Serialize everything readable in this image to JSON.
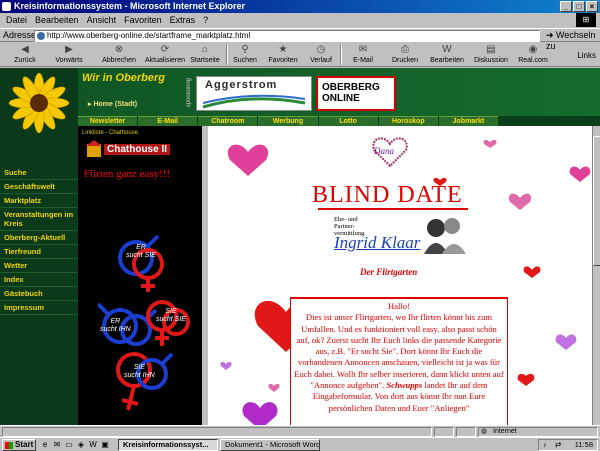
{
  "window": {
    "title": "Kreisinformationssystem - Microsoft Internet Explorer"
  },
  "menu": [
    "Datei",
    "Bearbeiten",
    "Ansicht",
    "Favoriten",
    "Extras",
    "?"
  ],
  "address": {
    "label": "Adresse",
    "url": "http://www.oberberg-online.de/startframe_marktplatz.html",
    "go_label": "Wechseln zu"
  },
  "toolbar": [
    {
      "label": "Zurück",
      "icon": "back-icon"
    },
    {
      "label": "Vorwärts",
      "icon": "forward-icon"
    },
    {
      "label": "Abbrechen",
      "icon": "stop-icon"
    },
    {
      "label": "Aktualisieren",
      "icon": "refresh-icon"
    },
    {
      "label": "Startseite",
      "icon": "home-icon"
    },
    {
      "label": "Suchen",
      "icon": "search-icon"
    },
    {
      "label": "Favoriten",
      "icon": "favorites-icon"
    },
    {
      "label": "Verlauf",
      "icon": "history-icon"
    },
    {
      "label": "E-Mail",
      "icon": "mail-icon"
    },
    {
      "label": "Drucken",
      "icon": "print-icon"
    },
    {
      "label": "Bearbeiten",
      "icon": "edit-icon"
    },
    {
      "label": "Diskussion",
      "icon": "discuss-icon"
    },
    {
      "label": "Real.com",
      "icon": "realcom-icon"
    }
  ],
  "toolbar_links": "Links",
  "site": {
    "logo": "Wir in Oberberg",
    "home_link": "Home (Stadt)",
    "sponsor_label": "sponsoring",
    "banner1": "Aggerstrom",
    "banner2_line1": "OBERBERG",
    "banner2_line2": "ONLINE",
    "tabs": [
      "Newsletter",
      "E-Mail",
      "Chatroom",
      "Werbung",
      "Lotto",
      "Horoskop",
      "Jobmarkt"
    ],
    "left_nav": [
      "Suche",
      "Geschäftswelt",
      "Marktplatz",
      "Veranstaltungen im Kreis",
      "Oberberg-Aktuell",
      "Tierfreund",
      "Wetter",
      "Index",
      "Gästebuch",
      "Impressum"
    ]
  },
  "chat": {
    "header": "Linkliste - Chathouse",
    "logo": "Chathouse II",
    "tagline": "Flirten ganz easy!!!",
    "symbols": [
      {
        "line1": "ER",
        "line2": "sucht SIE"
      },
      {
        "line1": "ER",
        "line2": "sucht IHN"
      },
      {
        "line1": "SIE",
        "line2": "sucht SIE"
      },
      {
        "line1": "SIE",
        "line2": "sucht IHN"
      }
    ]
  },
  "main": {
    "dana": "Dana",
    "title": "BLIND DATE",
    "ehe": "Ehe- und Partner- vermittlung",
    "ingrid": "Ingrid Klaar",
    "garten": "Der Flirtgarten",
    "greeting": "Hallo!",
    "body": "Dies ist unser Flirtgarten, wo Ihr flirten könnt bis zum Umfallen. Und es funktioniert voll easy, also passt schön auf, ok? Zuerst sucht Ihr Euch links die passende Kategorie aus, z.B. \"Er sucht Sie\". Dort könnt Ihr Euch die vorhandenen Annoncen anschauen, vielleicht ist ja was für Euch dabei. Wollt Ihr selber inserieren, dann klickt unten auf \"Annonce aufgeben\".",
    "schwupps": "Schwupps",
    "body2": "landet Ihr auf dem Eingabeformular. Von dort aus könnt Ihr nun Eure persönlichen Daten und Euer \"Anliegen\""
  },
  "status": {
    "zone": "Internet"
  },
  "taskbar": {
    "start": "Start",
    "tasks": [
      "Kreisinformationssyst...",
      "Dokument1 - Microsoft Word"
    ],
    "clock": "11:58"
  },
  "colors": {
    "heart_pink": "#e0409a",
    "heart_red": "#e01818",
    "heart_purple": "#b02ac8",
    "nav_yellow": "#f0d300",
    "title_red": "#e00000"
  }
}
